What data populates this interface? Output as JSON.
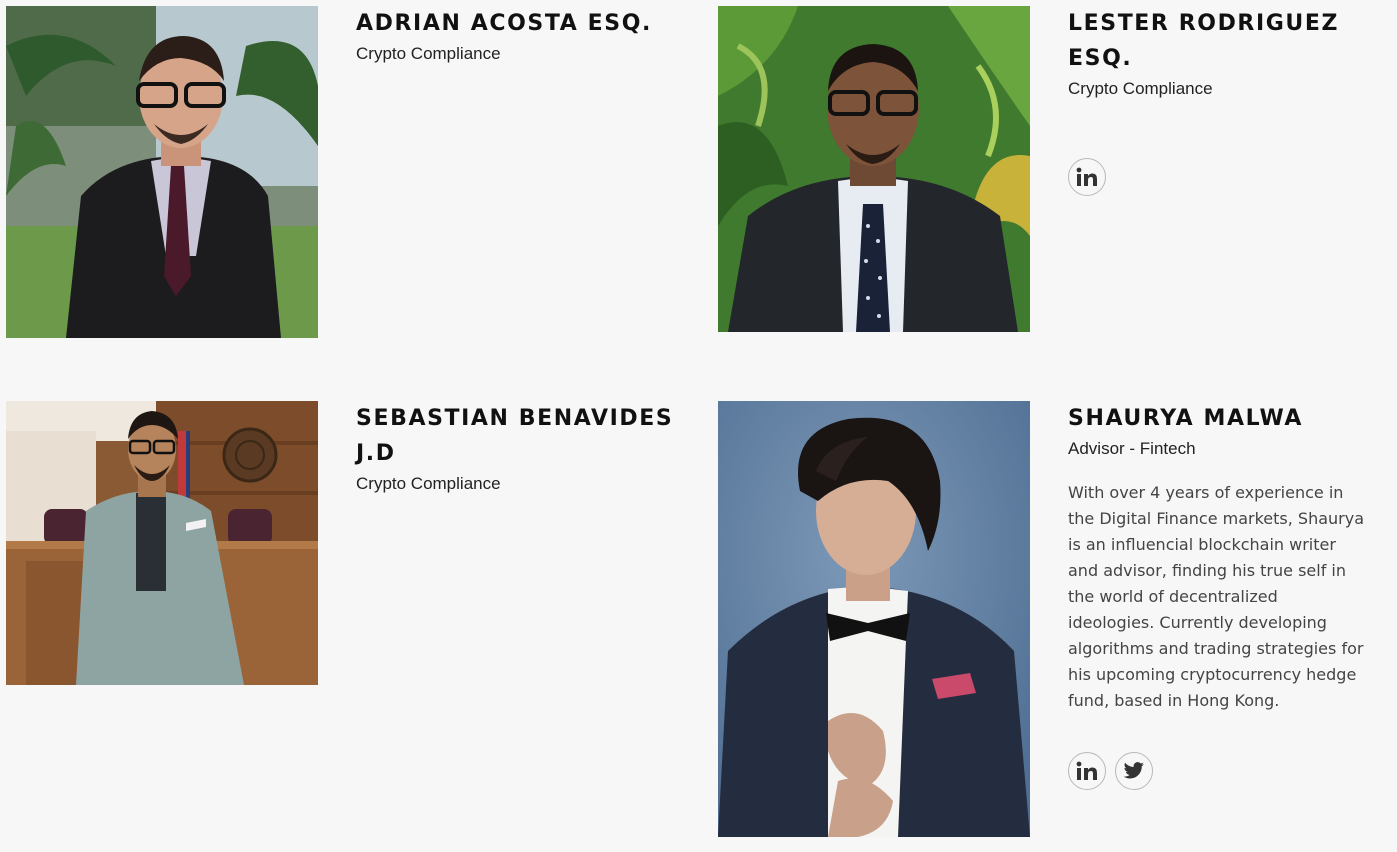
{
  "team": [
    {
      "name": "ADRIAN ACOSTA ESQ.",
      "role": "Crypto Compliance",
      "photo_icon": "person-photo"
    },
    {
      "name_line1": "LESTER RODRIGUEZ",
      "name_line2": "ESQ.",
      "role": "Crypto Compliance",
      "photo_icon": "person-photo",
      "socials": [
        {
          "icon": "linkedin-icon",
          "glyph": "in"
        }
      ]
    },
    {
      "name_line1": "SEBASTIAN BENAVIDES",
      "name_line2": "J.D",
      "role": "Crypto Compliance",
      "photo_icon": "person-photo"
    },
    {
      "name": "SHAURYA MALWA",
      "role": "Advisor - Fintech",
      "photo_icon": "person-photo",
      "bio_lines": [
        "With over 4 years of experience in",
        "the Digital Finance markets, Shaurya",
        "is an influencial blockchain writer",
        "and advisor, finding his true self in",
        "the world of decentralized",
        "ideologies. Currently developing",
        "algorithms and trading strategies for",
        "his upcoming cryptocurrency hedge",
        "fund, based in Hong Kong."
      ],
      "socials": [
        {
          "icon": "linkedin-icon",
          "glyph": "in"
        },
        {
          "icon": "twitter-icon"
        }
      ]
    }
  ],
  "colors": {
    "background": "#f7f7f7",
    "heading": "#111111",
    "body_text": "#444444",
    "social_border": "#b9b9b9",
    "icon": "#333333"
  }
}
